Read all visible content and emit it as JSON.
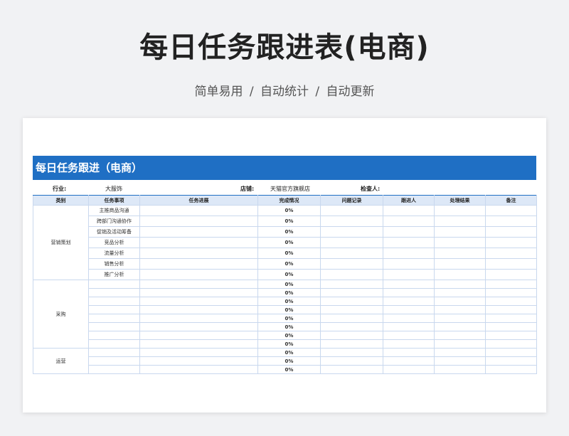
{
  "page": {
    "title": "每日任务跟进表(电商)",
    "subtitle": "简单易用  /  自动统计  /  自动更新"
  },
  "sheet": {
    "banner": "每日任务跟进（电商）",
    "info": {
      "industry_label": "行业:",
      "industry_value": "大服饰",
      "shop_label": "店铺:",
      "shop_value": "天猫官方旗舰店",
      "inspector_label": "检查人:",
      "inspector_value": ""
    },
    "headers": [
      "类别",
      "任务事项",
      "任务进展",
      "完成情况",
      "问题记录",
      "跟进人",
      "处理结果",
      "备注"
    ],
    "groups": [
      {
        "category": "营销策划",
        "rows": [
          {
            "task": "主推商品沟通",
            "progress": "",
            "completion": "0%",
            "issues": "",
            "follower": "",
            "result": "",
            "note": ""
          },
          {
            "task": "跨部门沟通协作",
            "progress": "",
            "completion": "0%",
            "issues": "",
            "follower": "",
            "result": "",
            "note": ""
          },
          {
            "task": "促销及活动筹备",
            "progress": "",
            "completion": "0%",
            "issues": "",
            "follower": "",
            "result": "",
            "note": ""
          },
          {
            "task": "竞品分析",
            "progress": "",
            "completion": "0%",
            "issues": "",
            "follower": "",
            "result": "",
            "note": ""
          },
          {
            "task": "流量分析",
            "progress": "",
            "completion": "0%",
            "issues": "",
            "follower": "",
            "result": "",
            "note": ""
          },
          {
            "task": "销售分析",
            "progress": "",
            "completion": "0%",
            "issues": "",
            "follower": "",
            "result": "",
            "note": ""
          },
          {
            "task": "推广分析",
            "progress": "",
            "completion": "0%",
            "issues": "",
            "follower": "",
            "result": "",
            "note": ""
          }
        ]
      },
      {
        "category": "采购",
        "rows": [
          {
            "task": "",
            "progress": "",
            "completion": "0%",
            "issues": "",
            "follower": "",
            "result": "",
            "note": ""
          },
          {
            "task": "",
            "progress": "",
            "completion": "0%",
            "issues": "",
            "follower": "",
            "result": "",
            "note": ""
          },
          {
            "task": "",
            "progress": "",
            "completion": "0%",
            "issues": "",
            "follower": "",
            "result": "",
            "note": ""
          },
          {
            "task": "",
            "progress": "",
            "completion": "0%",
            "issues": "",
            "follower": "",
            "result": "",
            "note": ""
          },
          {
            "task": "",
            "progress": "",
            "completion": "0%",
            "issues": "",
            "follower": "",
            "result": "",
            "note": ""
          },
          {
            "task": "",
            "progress": "",
            "completion": "0%",
            "issues": "",
            "follower": "",
            "result": "",
            "note": ""
          },
          {
            "task": "",
            "progress": "",
            "completion": "0%",
            "issues": "",
            "follower": "",
            "result": "",
            "note": ""
          },
          {
            "task": "",
            "progress": "",
            "completion": "0%",
            "issues": "",
            "follower": "",
            "result": "",
            "note": ""
          }
        ]
      },
      {
        "category": "运营",
        "rows": [
          {
            "task": "",
            "progress": "",
            "completion": "0%",
            "issues": "",
            "follower": "",
            "result": "",
            "note": ""
          },
          {
            "task": "",
            "progress": "",
            "completion": "0%",
            "issues": "",
            "follower": "",
            "result": "",
            "note": ""
          },
          {
            "task": "",
            "progress": "",
            "completion": "0%",
            "issues": "",
            "follower": "",
            "result": "",
            "note": ""
          }
        ]
      }
    ],
    "colors": {
      "accent": "#1f6fc4",
      "header_bg": "#dde8f7",
      "grid": "#c9d8ee"
    }
  }
}
